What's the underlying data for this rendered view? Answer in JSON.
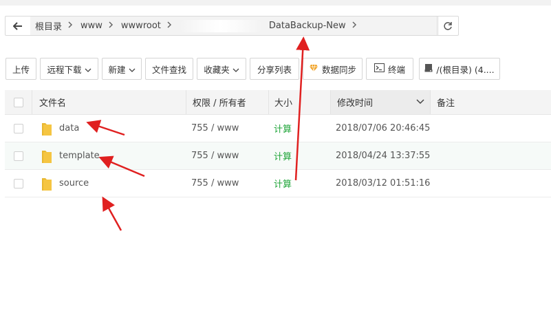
{
  "breadcrumb": {
    "items": [
      "根目录",
      "www",
      "wwwroot",
      "DataBackup-New"
    ]
  },
  "toolbar": {
    "upload": "上传",
    "remote_download": "远程下载",
    "new": "新建",
    "file_search": "文件查找",
    "favorites": "收藏夹",
    "share_list": "分享列表",
    "data_sync": "数据同步",
    "terminal": "终端",
    "disk": "/(根目录) (4...."
  },
  "table": {
    "headers": {
      "name": "文件名",
      "perm": "权限 / 所有者",
      "size": "大小",
      "mtime": "修改时间",
      "note": "备注"
    },
    "rows": [
      {
        "name": "data",
        "perm": "755 / www",
        "size": "计算",
        "mtime": "2018/07/06 20:46:45"
      },
      {
        "name": "template",
        "perm": "755 / www",
        "size": "计算",
        "mtime": "2018/04/24 13:37:55"
      },
      {
        "name": "source",
        "perm": "755 / www",
        "size": "计算",
        "mtime": "2018/03/12 01:51:16"
      }
    ]
  },
  "colors": {
    "accent_green": "#20a53a",
    "annotation_red": "#e02020",
    "folder_yellow": "#f5c542"
  }
}
